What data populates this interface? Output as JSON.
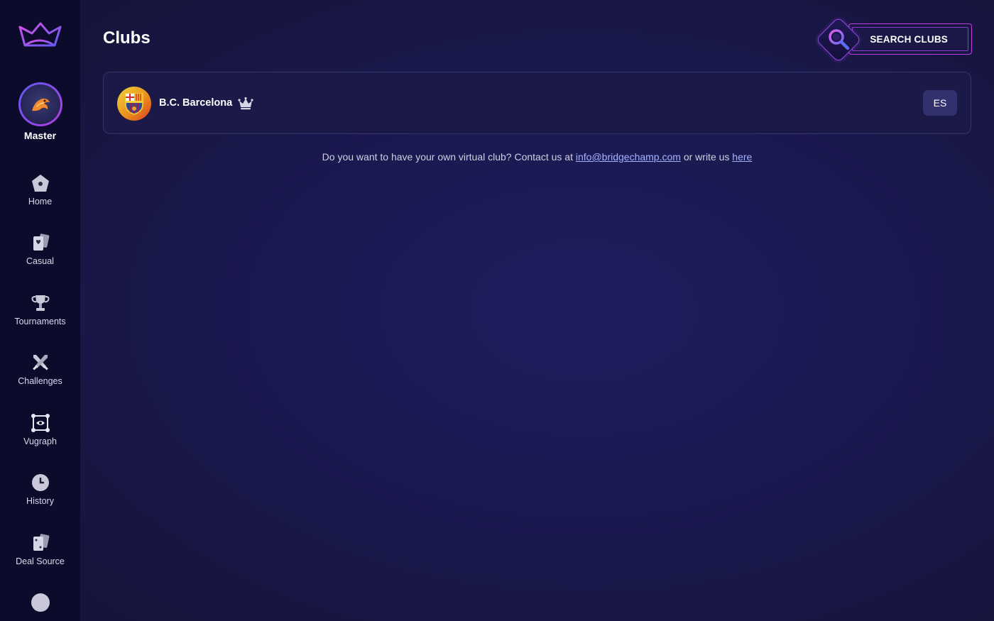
{
  "sidebar": {
    "rank_label": "Master",
    "items": [
      {
        "label": "Home",
        "icon": "home-icon"
      },
      {
        "label": "Casual",
        "icon": "cards-icon"
      },
      {
        "label": "Tournaments",
        "icon": "trophy-icon"
      },
      {
        "label": "Challenges",
        "icon": "swords-icon"
      },
      {
        "label": "Vugraph",
        "icon": "eye-icon"
      },
      {
        "label": "History",
        "icon": "clock-icon"
      },
      {
        "label": "Deal Source",
        "icon": "deal-cards-icon"
      },
      {
        "label": "",
        "icon": "chat-icon"
      }
    ]
  },
  "header": {
    "title": "Clubs",
    "search_label": "SEARCH CLUBS"
  },
  "clubs": [
    {
      "name": "B.C. Barcelona",
      "language": "ES",
      "owner_badge": "crown-icon"
    }
  ],
  "contact": {
    "prefix": "Do you want to have your own virtual club? Contact us at",
    "email": "info@bridgechamp.com",
    "middle": "or write us",
    "link_text": "here"
  },
  "colors": {
    "sidebar_bg": "#0c0b2c",
    "main_bg": "#1a1950",
    "accent_pink": "#c03ee0",
    "accent_violet": "#8f45e6",
    "link": "#a3b4ff"
  }
}
